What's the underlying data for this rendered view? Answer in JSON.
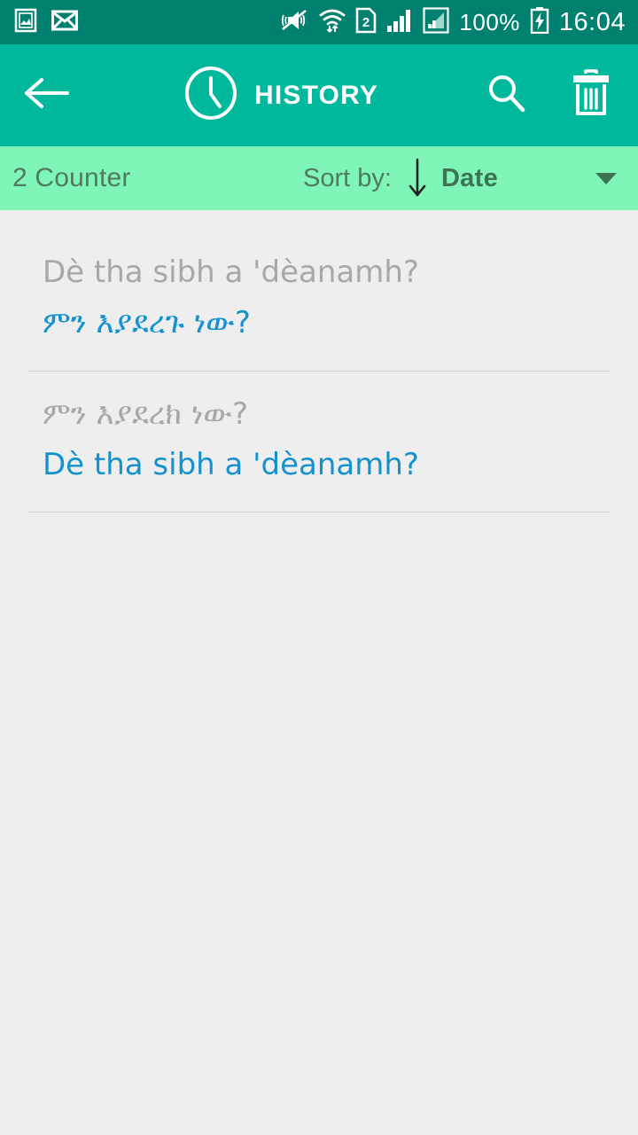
{
  "status_bar": {
    "background": "#00806f",
    "left_icons": [
      "gallery-icon",
      "envelope-icon"
    ],
    "right_icons": [
      "mute-vibrate-icon",
      "wifi-transfer-icon",
      "sim2-icon",
      "signal-bars-icon",
      "signal-boxed-icon"
    ],
    "battery_percent": "100%",
    "battery_state": "charging",
    "clock": "16:04"
  },
  "app_bar": {
    "background": "#00b89c",
    "back_icon": "back-arrow-icon",
    "title_icon": "clock-icon",
    "title": "HISTORY",
    "search_icon": "search-icon",
    "delete_icon": "trash-icon"
  },
  "sort_bar": {
    "background": "#80f5b8",
    "counter": "2 Counter",
    "sort_label": "Sort by:",
    "sort_direction_icon": "arrow-down-icon",
    "sort_value": "Date",
    "dropdown_icon": "caret-down-icon"
  },
  "history": {
    "source_color": "#a8a8a8",
    "target_color": "#1592ce",
    "items": [
      {
        "source": "Dè tha sibh a 'dèanamh?",
        "target": "ምን እያደረጉ ነው?"
      },
      {
        "source": "ምን እያደረክ ነው?",
        "target": "Dè tha sibh a 'dèanamh?"
      }
    ]
  }
}
